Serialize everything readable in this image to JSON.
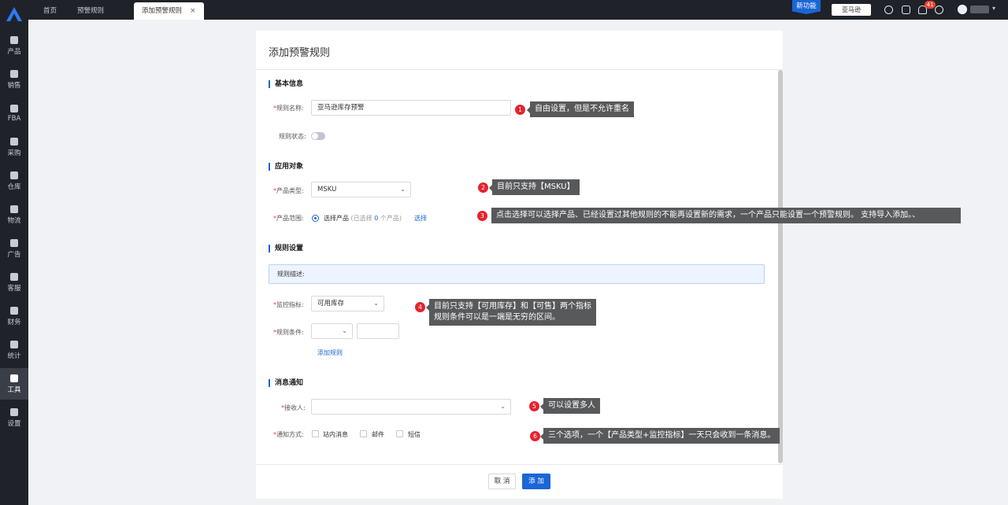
{
  "sidebar": {
    "items": [
      {
        "label": "产品",
        "icon": "product-icon"
      },
      {
        "label": "销售",
        "icon": "sales-icon"
      },
      {
        "label": "FBA",
        "icon": "fba-icon"
      },
      {
        "label": "采购",
        "icon": "purchase-icon"
      },
      {
        "label": "仓库",
        "icon": "warehouse-icon"
      },
      {
        "label": "物流",
        "icon": "logistics-icon"
      },
      {
        "label": "广告",
        "icon": "ad-icon"
      },
      {
        "label": "客服",
        "icon": "service-icon"
      },
      {
        "label": "财务",
        "icon": "finance-icon"
      },
      {
        "label": "统计",
        "icon": "stats-icon"
      },
      {
        "label": "工具",
        "icon": "tools-icon",
        "active": true
      },
      {
        "label": "设置",
        "icon": "settings-icon"
      }
    ]
  },
  "tabs": [
    {
      "label": "首页"
    },
    {
      "label": "预警规则"
    },
    {
      "label": "添加预警规则",
      "active": true,
      "close": "×"
    }
  ],
  "topbar": {
    "new_feature": "新功能",
    "amazon_label": "亚马逊",
    "notification_count": "41"
  },
  "page": {
    "title": "添加预警规则"
  },
  "basic": {
    "section": "基本信息",
    "name_label": "规则名称:",
    "name_value": "亚马逊库存预警",
    "status_label": "规则状态:"
  },
  "target": {
    "section": "应用对象",
    "product_type_label": "产品类型:",
    "product_type_value": "MSKU",
    "product_range_label": "产品范围:",
    "product_range_option": "选择产品",
    "product_range_count_pre": "(已选择",
    "product_range_count": "0",
    "product_range_count_post": "个产品)",
    "select_link": "选择"
  },
  "rules": {
    "section": "规则设置",
    "desc": "规则描述:",
    "metric_label": "监控指标:",
    "metric_value": "可用库存",
    "condition_label": "规则条件:",
    "add_rule": "添加规则"
  },
  "notify": {
    "section": "消息通知",
    "receiver_label": "接收人:",
    "method_label": "通知方式:",
    "methods": [
      "站内消息",
      "邮件",
      "短信"
    ]
  },
  "buttons": {
    "cancel": "取 消",
    "add": "添 加"
  },
  "annotations": [
    {
      "num": "1",
      "text": "自由设置，但是不允许重名"
    },
    {
      "num": "2",
      "text": "目前只支持【MSKU】"
    },
    {
      "num": "3",
      "text": "点击选择可以选择产品、已经设置过其他规则的不能再设置新的需求，一个产品只能设置一个预警规则。 支持导入添加。、"
    },
    {
      "num": "4",
      "text_line1": "目前只支持【可用库存】和【可售】两个指标",
      "text_line2": "规则条件可以是一端是无穷的区间。"
    },
    {
      "num": "5",
      "text": "可以设置多人"
    },
    {
      "num": "6",
      "text": "三个选项，一个【产品类型+监控指标】一天只会收到一条消息。"
    }
  ],
  "colors": {
    "primary": "#1a66d6",
    "sidebar_bg": "#1f2329",
    "annotation_dot": "#e5232d",
    "annotation_bg": "#58595b"
  }
}
